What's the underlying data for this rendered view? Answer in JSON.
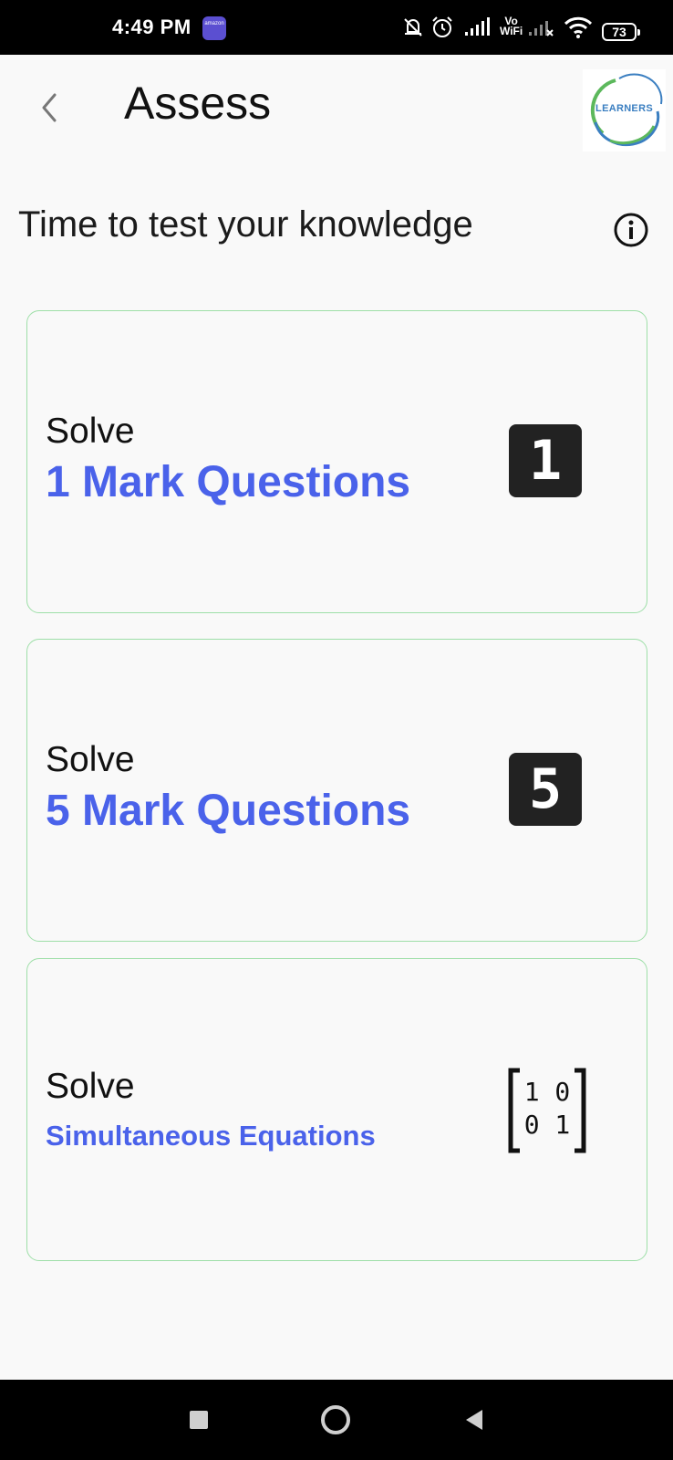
{
  "status_bar": {
    "time": "4:49 PM",
    "notification_app": "amazon",
    "network_label_top": "Vo",
    "network_label_bottom": "WiFi",
    "battery": "73",
    "icons": [
      "amazon-app-icon",
      "mute-icon",
      "alarm-icon",
      "signal-icon",
      "signal-weak-icon",
      "wifi-icon",
      "battery-icon"
    ]
  },
  "app_bar": {
    "title": "Assess",
    "back_icon": "chevron-left-icon",
    "logo_text": "LEARNERS"
  },
  "intro": {
    "text": "Time to test your knowledge",
    "info_icon": "info-icon"
  },
  "cards": [
    {
      "solve_label": "Solve",
      "title": "1 Mark Questions",
      "badge": "1",
      "icon": "number-one-icon"
    },
    {
      "solve_label": "Solve",
      "title": "5 Mark Questions",
      "badge": "5",
      "icon": "number-five-icon"
    },
    {
      "solve_label": "Solve",
      "title": "Simultaneous Equations",
      "matrix_row1": "1 0",
      "matrix_row2": "0 1",
      "icon": "identity-matrix-icon"
    }
  ],
  "nav_bar": {
    "icons": [
      "recents-square-icon",
      "home-circle-icon",
      "back-triangle-icon"
    ]
  },
  "colors": {
    "accent_blue": "#4a62ea",
    "card_border": "#9edfa8",
    "badge_bg": "#222222",
    "background": "#f9f9f9"
  }
}
